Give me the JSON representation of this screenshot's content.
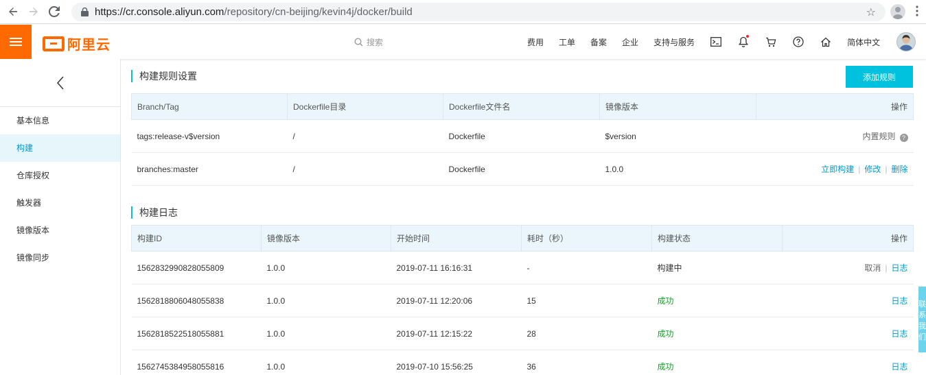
{
  "browser": {
    "url_host": "https://cr.console.aliyun.com",
    "url_path": "/repository/cn-beijing/kevin4j/docker/build"
  },
  "header": {
    "logo_text": "阿里云",
    "search_placeholder": "搜索",
    "nav": [
      "费用",
      "工单",
      "备案",
      "企业",
      "支持与服务"
    ],
    "language": "简体中文"
  },
  "sidebar": {
    "items": [
      {
        "label": "基本信息",
        "active": false
      },
      {
        "label": "构建",
        "active": true
      },
      {
        "label": "仓库授权",
        "active": false
      },
      {
        "label": "触发器",
        "active": false
      },
      {
        "label": "镜像版本",
        "active": false
      },
      {
        "label": "镜像同步",
        "active": false
      }
    ]
  },
  "rules": {
    "title": "构建规则设置",
    "add_button": "添加规则",
    "columns": [
      "Branch/Tag",
      "Dockerfile目录",
      "Dockerfile文件名",
      "镜像版本",
      "操作"
    ],
    "rows": [
      {
        "branch": "tags:release-v$version",
        "dir": "/",
        "file": "Dockerfile",
        "version": "$version",
        "action": "内置规则"
      },
      {
        "branch": "branches:master",
        "dir": "/",
        "file": "Dockerfile",
        "version": "1.0.0",
        "actions": [
          "立即构建",
          "修改",
          "删除"
        ]
      }
    ]
  },
  "logs": {
    "title": "构建日志",
    "columns": [
      "构建ID",
      "镜像版本",
      "开始时间",
      "耗时（秒）",
      "构建状态",
      "操作"
    ],
    "rows": [
      {
        "id": "1562832990828055809",
        "version": "1.0.0",
        "start": "2019-07-11 16:16:31",
        "duration": "-",
        "status": "构建中",
        "cancel": "取消",
        "log": "日志"
      },
      {
        "id": "1562818806048055838",
        "version": "1.0.0",
        "start": "2019-07-11 12:20:06",
        "duration": "15",
        "status": "成功",
        "log": "日志"
      },
      {
        "id": "1562818522518055881",
        "version": "1.0.0",
        "start": "2019-07-11 12:15:22",
        "duration": "28",
        "status": "成功",
        "log": "日志"
      },
      {
        "id": "1562745384958055816",
        "version": "1.0.0",
        "start": "2019-07-10 15:56:25",
        "duration": "36",
        "status": "成功",
        "log": "日志"
      }
    ]
  },
  "float_tab": "联系我们",
  "colors": {
    "brand": "#ff6a00",
    "accent": "#00c1de",
    "link": "#0099cc",
    "success": "#1ca02e"
  }
}
